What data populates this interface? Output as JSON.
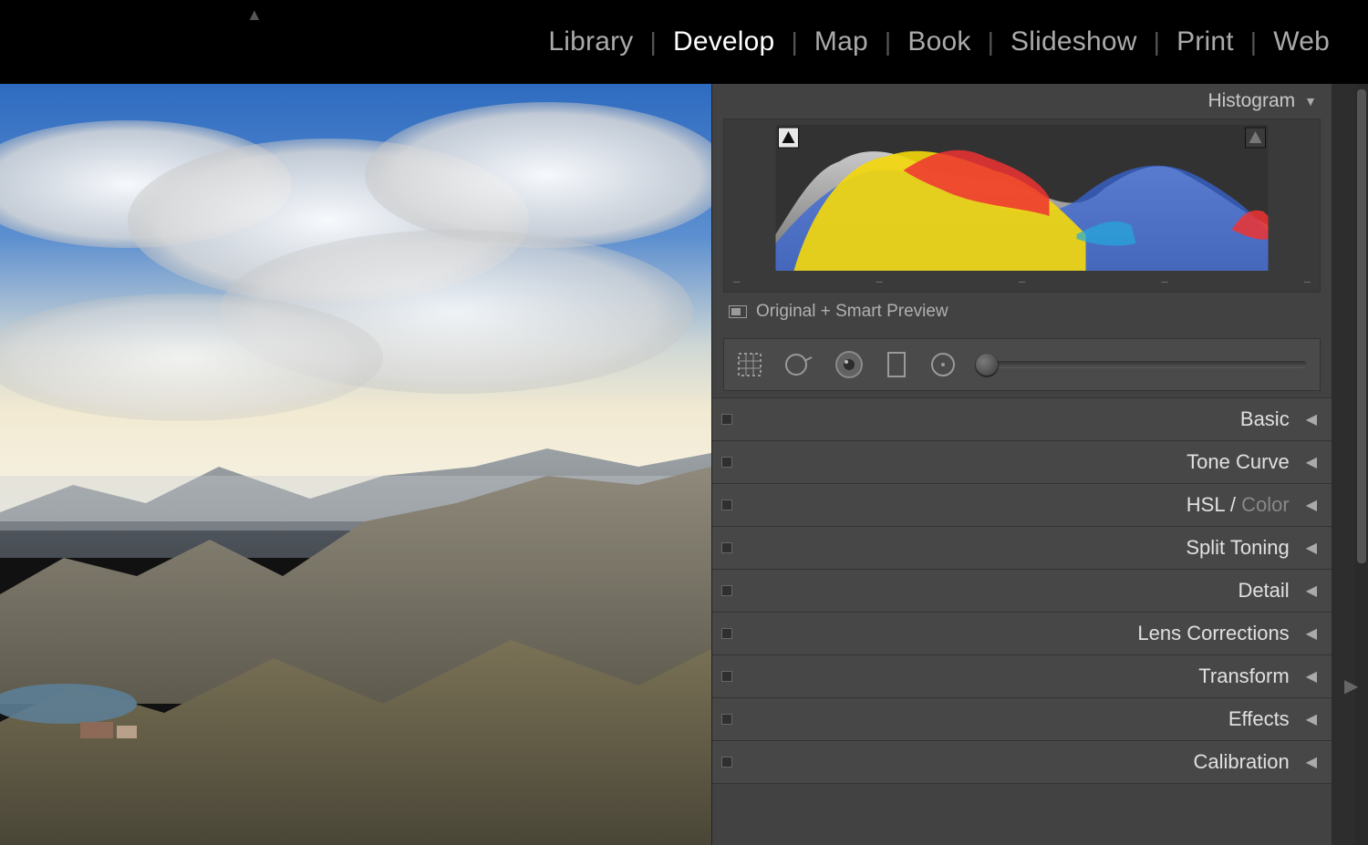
{
  "nav": {
    "modules": [
      "Library",
      "Develop",
      "Map",
      "Book",
      "Slideshow",
      "Print",
      "Web"
    ],
    "active": "Develop"
  },
  "histogram": {
    "title": "Histogram",
    "preview_label": "Original + Smart Preview",
    "ticks": [
      "–",
      "–",
      "–",
      "–",
      "–"
    ]
  },
  "tools": {
    "crop": "crop-tool",
    "spot": "spot-removal-tool",
    "redeye": "redeye-tool",
    "grad": "graduated-filter-tool",
    "radial": "radial-filter-tool",
    "brush": "adjustment-brush-tool"
  },
  "panels": [
    {
      "label": "Basic",
      "dim": ""
    },
    {
      "label": "Tone Curve",
      "dim": ""
    },
    {
      "label": "HSL / ",
      "dim": "Color"
    },
    {
      "label": "Split Toning",
      "dim": ""
    },
    {
      "label": "Detail",
      "dim": ""
    },
    {
      "label": "Lens Corrections",
      "dim": ""
    },
    {
      "label": "Transform",
      "dim": ""
    },
    {
      "label": "Effects",
      "dim": ""
    },
    {
      "label": "Calibration",
      "dim": ""
    }
  ]
}
